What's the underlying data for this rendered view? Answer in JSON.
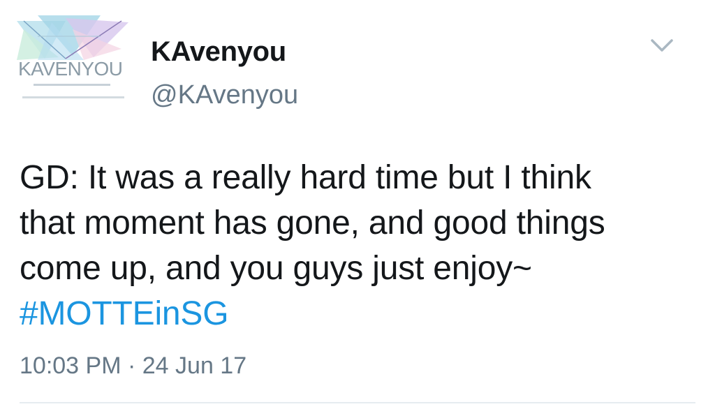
{
  "tweet": {
    "author": {
      "display_name": "KAvenyou",
      "handle": "@KAvenyou",
      "avatar_logo_text": "KAVENYOU",
      "avatar_icon": "kavenyou-logo"
    },
    "menu_icon": "chevron-down-icon",
    "text_lines": [
      "GD: It was a really hard time but I think",
      "that moment has gone, and good things",
      "come up, and you guys just enjoy~"
    ],
    "hashtag": "#MOTTEinSG",
    "time": "10:03 PM",
    "separator": "·",
    "date": "24 Jun 17",
    "colors": {
      "text": "#14171a",
      "secondary": "#657786",
      "link": "#1b95e0"
    }
  }
}
